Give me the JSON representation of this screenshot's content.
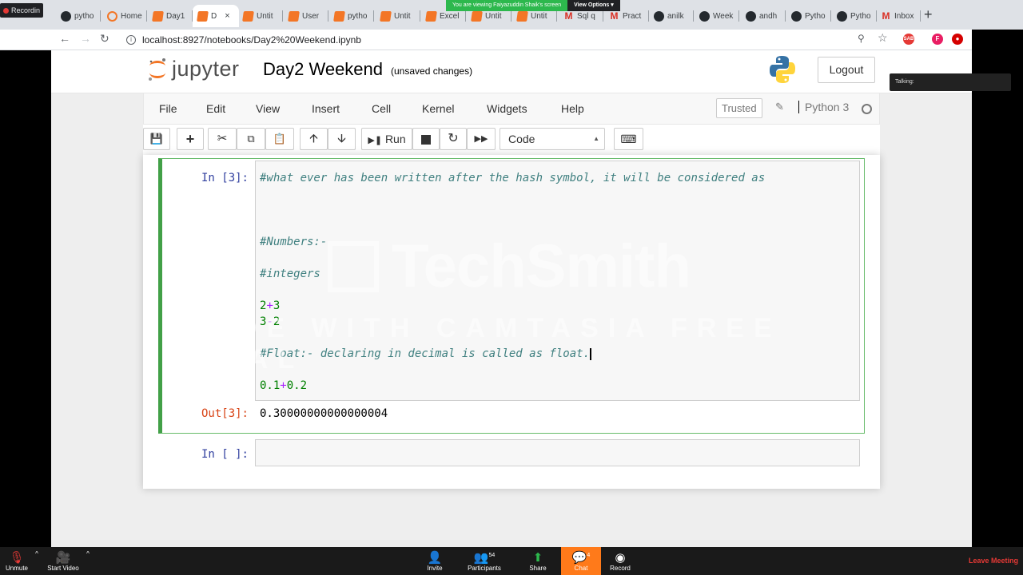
{
  "browser": {
    "recording_label": "Recordin",
    "tabs": [
      {
        "label": "pytho",
        "icon": "github-icon"
      },
      {
        "label": "Home",
        "icon": "jupyter-home-icon"
      },
      {
        "label": "Day1",
        "icon": "jupyter-icon"
      },
      {
        "label": "D",
        "icon": "jupyter-icon",
        "active": true
      },
      {
        "label": "Untit",
        "icon": "jupyter-icon"
      },
      {
        "label": "User",
        "icon": "jupyter-icon"
      },
      {
        "label": "pytho",
        "icon": "jupyter-icon"
      },
      {
        "label": "Untit",
        "icon": "jupyter-icon"
      },
      {
        "label": "Excel",
        "icon": "jupyter-icon"
      },
      {
        "label": "Untit",
        "icon": "jupyter-icon"
      },
      {
        "label": "Untit",
        "icon": "jupyter-icon"
      },
      {
        "label": "Sql q",
        "icon": "gmail-icon"
      },
      {
        "label": "Pract",
        "icon": "gmail-icon"
      },
      {
        "label": "anilk",
        "icon": "github-icon"
      },
      {
        "label": "Week",
        "icon": "github-icon"
      },
      {
        "label": "andh",
        "icon": "github-icon"
      },
      {
        "label": "Pytho",
        "icon": "github-icon"
      },
      {
        "label": "Pytho",
        "icon": "github-icon"
      },
      {
        "label": "Inbox",
        "icon": "gmail-icon"
      }
    ],
    "tab_close": "×",
    "new_tab": "+",
    "url": "localhost:8927/notebooks/Day2%20Weekend.ipynb",
    "profile_initial": "F",
    "ext_badge": "SAB"
  },
  "screen_share": {
    "viewing_label": "You are viewing Faiyazuddin Shaik's screen",
    "view_options": "View Options ▾",
    "talking_label": "Talking:"
  },
  "jupyter": {
    "logo_text": "jupyter",
    "notebook_name": "Day2 Weekend",
    "save_status": "(unsaved changes)",
    "logout": "Logout",
    "menu": [
      "File",
      "Edit",
      "View",
      "Insert",
      "Cell",
      "Kernel",
      "Widgets",
      "Help"
    ],
    "trusted": "Trusted",
    "kernel_name": "Python 3",
    "toolbar": {
      "run": "Run",
      "cell_type": "Code"
    }
  },
  "cells": {
    "cell1": {
      "in_prompt": "In [3]:",
      "out_prompt": "Out[3]:",
      "line1": "#what ever has been written after the hash symbol, it will be considered as",
      "line_numbers": "#Numbers:-",
      "line_integers": "#integers",
      "expr1_a": "2",
      "expr1_op": "+",
      "expr1_b": "3",
      "expr2_a": "3",
      "expr2_op": "-",
      "expr2_b": "2",
      "line_float": "#Float:- declaring in decimal is called as float.",
      "expr3_a": "0.1",
      "expr3_op": "+",
      "expr3_b": "0.2",
      "output": "0.30000000000000004"
    },
    "cell2": {
      "in_prompt": "In [ ]:"
    }
  },
  "watermark": {
    "brand": "TechSmith",
    "trial": "MADE WITH CAMTASIA FREE TRIAL"
  },
  "zoom": {
    "unmute": "Unmute",
    "start_video": "Start Video",
    "invite": "Invite",
    "participants": "Participants",
    "participants_count": "54",
    "share": "Share",
    "chat": "Chat",
    "chat_count": "4",
    "record": "Record",
    "leave": "Leave Meeting"
  }
}
